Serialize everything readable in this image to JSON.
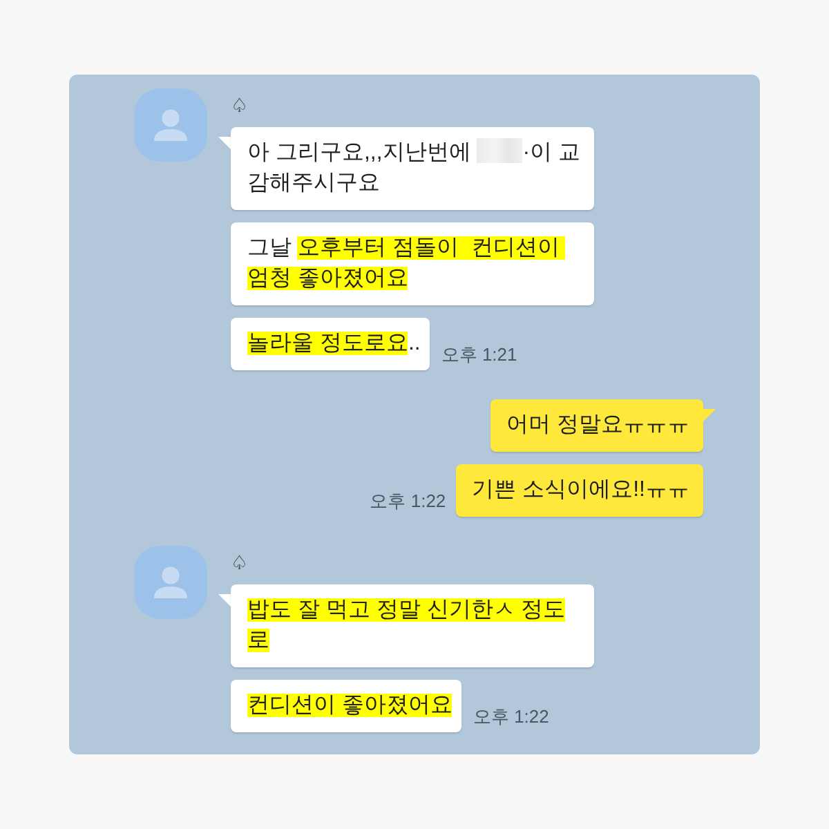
{
  "chat": {
    "groups": [
      {
        "kind": "received",
        "sender": "♤",
        "time": "오후 1:21",
        "messages": [
          {
            "segments": [
              {
                "kind": "text",
                "text": "아 그리구요,,,지난번에 ",
                "highlighted": false
              },
              {
                "kind": "redacted"
              },
              {
                "kind": "text",
                "text": "·이 교감해주시구요",
                "highlighted": false
              }
            ]
          },
          {
            "segments": [
              {
                "kind": "text",
                "text": "그날 ",
                "highlighted": false
              },
              {
                "kind": "text",
                "text": "오후부터 점돌이  컨디션이 엄청 좋아졌어요",
                "highlighted": true
              }
            ]
          },
          {
            "segments": [
              {
                "kind": "text",
                "text": "놀라울 정도로요",
                "highlighted": true
              },
              {
                "kind": "text",
                "text": "..",
                "highlighted": false
              }
            ]
          }
        ]
      },
      {
        "kind": "sent",
        "time": "오후 1:22",
        "messages": [
          {
            "segments": [
              {
                "kind": "text",
                "text": "어머 정말요ㅠㅠㅠ",
                "highlighted": false
              }
            ]
          },
          {
            "segments": [
              {
                "kind": "text",
                "text": "기쁜 소식이에요!!ㅠㅠ",
                "highlighted": false
              }
            ]
          }
        ]
      },
      {
        "kind": "received",
        "sender": "♤",
        "time": "오후 1:22",
        "messages": [
          {
            "segments": [
              {
                "kind": "text",
                "text": "밥도 잘 먹고 정말 신기한ㅅ 정도로",
                "highlighted": true
              }
            ]
          },
          {
            "segments": [
              {
                "kind": "text",
                "text": "컨디션이 좋아졌어요",
                "highlighted": true
              }
            ]
          }
        ]
      }
    ]
  }
}
